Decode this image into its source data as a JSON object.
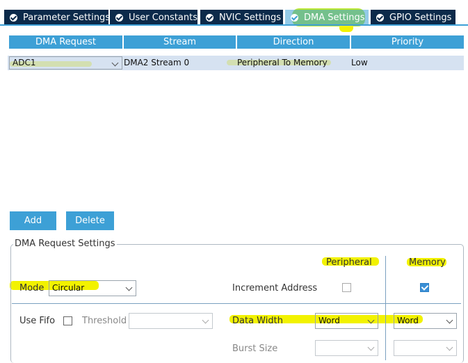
{
  "tabs": [
    {
      "label": "Parameter Settings"
    },
    {
      "label": "User Constants"
    },
    {
      "label": "NVIC Settings"
    },
    {
      "label": "DMA Settings"
    },
    {
      "label": "GPIO Settings"
    }
  ],
  "table": {
    "headers": [
      "DMA Request",
      "Stream",
      "Direction",
      "Priority"
    ],
    "rows": [
      {
        "request": "ADC1",
        "stream": "DMA2 Stream 0",
        "direction": "Peripheral To Memory",
        "priority": "Low"
      }
    ]
  },
  "buttons": {
    "add": "Add",
    "delete": "Delete"
  },
  "settings": {
    "title": "DMA Request Settings",
    "peripheral_header": "Peripheral",
    "memory_header": "Memory",
    "mode_label": "Mode",
    "mode_value": "Circular",
    "increment_label": "Increment Address",
    "peripheral_increment": false,
    "memory_increment": true,
    "use_fifo_label": "Use Fifo",
    "use_fifo": false,
    "threshold_label": "Threshold",
    "threshold_value": "",
    "data_width_label": "Data Width",
    "peripheral_data_width": "Word",
    "memory_data_width": "Word",
    "burst_size_label": "Burst Size",
    "peripheral_burst_size": "",
    "memory_burst_size": ""
  },
  "colors": {
    "tab_bg": "#0c2a4a",
    "accent": "#3da0d6",
    "selected_row": "#c8d8ec",
    "highlight": "#f2f200"
  }
}
